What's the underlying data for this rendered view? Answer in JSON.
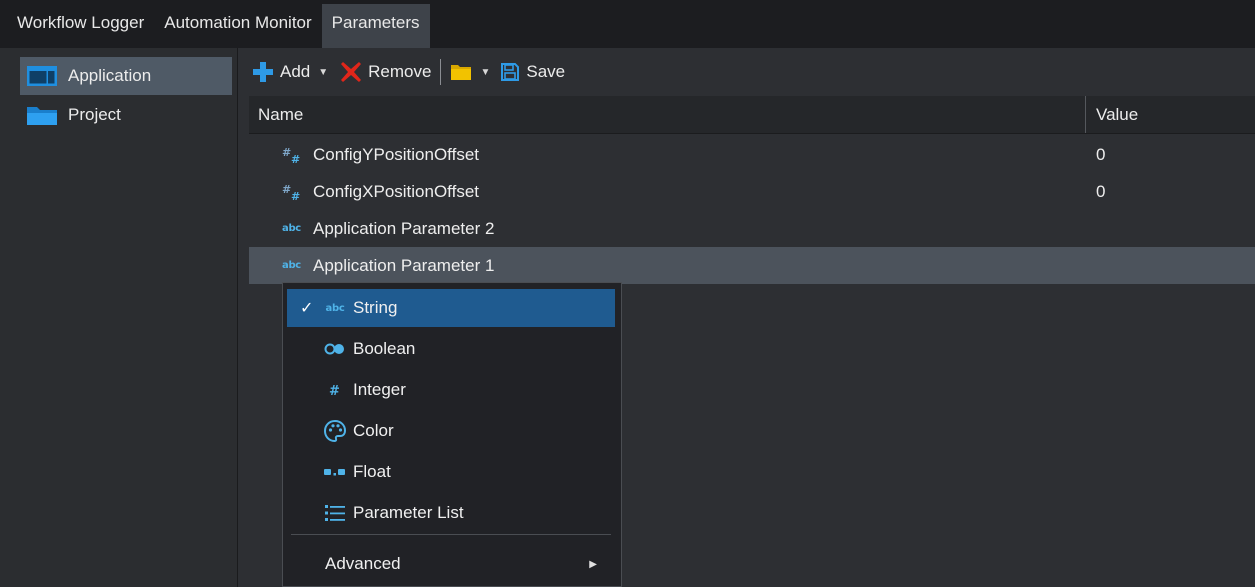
{
  "tabs": [
    {
      "label": "Workflow Logger"
    },
    {
      "label": "Automation Monitor"
    },
    {
      "label": "Parameters",
      "active": true
    }
  ],
  "sidebar": {
    "items": [
      {
        "label": "Application",
        "selected": true
      },
      {
        "label": "Project"
      }
    ]
  },
  "toolbar": {
    "add_label": "Add",
    "remove_label": "Remove",
    "save_label": "Save"
  },
  "table": {
    "columns": [
      "Name",
      "Value"
    ],
    "rows": [
      {
        "name": "ConfigYPositionOffset",
        "value": "0",
        "type": "integer"
      },
      {
        "name": "ConfigXPositionOffset",
        "value": "0",
        "type": "integer"
      },
      {
        "name": "Application Parameter 2",
        "value": "",
        "type": "string"
      },
      {
        "name": "Application Parameter 1",
        "value": "",
        "type": "string",
        "selected": true
      }
    ]
  },
  "type_menu": {
    "items": [
      {
        "label": "String",
        "icon": "abc-icon",
        "checked": true
      },
      {
        "label": "Boolean",
        "icon": "toggle-icon"
      },
      {
        "label": "Integer",
        "icon": "hash-icon"
      },
      {
        "label": "Color",
        "icon": "palette-icon"
      },
      {
        "label": "Float",
        "icon": "float-icon"
      },
      {
        "label": "Parameter List",
        "icon": "list-icon"
      }
    ],
    "advanced_label": "Advanced"
  },
  "colors": {
    "accent": "#1f5b90",
    "icon_blue": "#2e9ae6",
    "remove_red": "#e0261a",
    "folder_yellow": "#f2c200"
  }
}
